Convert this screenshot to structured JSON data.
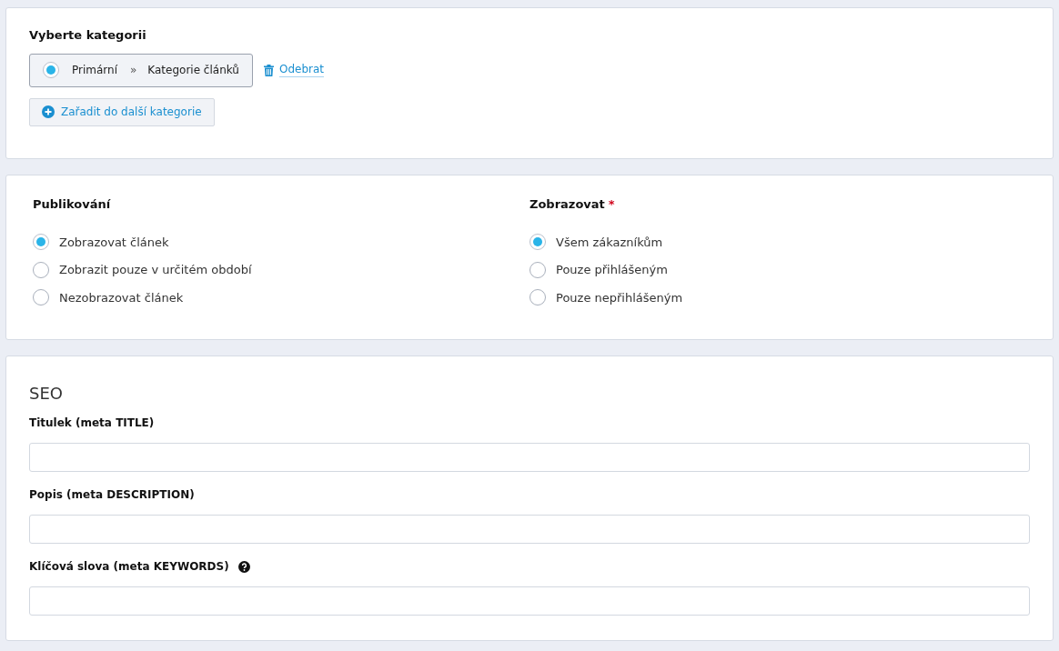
{
  "category_section": {
    "title": "Vyberte kategorii",
    "categories": [
      {
        "selected": true,
        "type": "Primární",
        "separator": "»",
        "name": "Kategorie článků",
        "remove_label": "Odebrat"
      }
    ],
    "add_button": "Zařadit do další kategorie"
  },
  "publishing": {
    "title": "Publikování",
    "options": [
      {
        "label": "Zobrazovat článek",
        "selected": true
      },
      {
        "label": "Zobrazit pouze v určitém období",
        "selected": false
      },
      {
        "label": "Nezobrazovat článek",
        "selected": false
      }
    ]
  },
  "visibility": {
    "title": "Zobrazovat",
    "required_mark": "*",
    "options": [
      {
        "label": "Všem zákazníkům",
        "selected": true
      },
      {
        "label": "Pouze přihlášeným",
        "selected": false
      },
      {
        "label": "Pouze nepřihlášeným",
        "selected": false
      }
    ]
  },
  "seo": {
    "title": "SEO",
    "fields": [
      {
        "label": "Titulek (meta TITLE)",
        "help": false
      },
      {
        "label": "Popis (meta DESCRIPTION)",
        "help": false
      },
      {
        "label": "Klíčová slova (meta KEYWORDS)",
        "help": true
      }
    ]
  }
}
